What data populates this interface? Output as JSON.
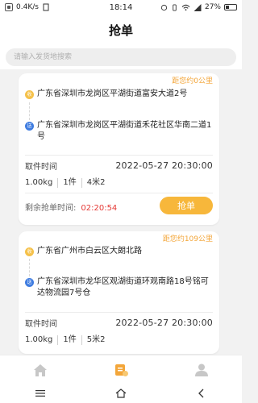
{
  "status_bar": {
    "speed": "0.4K/s",
    "time": "18:14",
    "battery": "27%"
  },
  "header": {
    "title": "抢单"
  },
  "search": {
    "placeholder": "请输入发货地搜索"
  },
  "orders": [
    {
      "distance": "距您约0公里",
      "pickup_badge": "收",
      "pickup_address": "广东省深圳市龙岗区平湖街道富安大道2号",
      "delivery_badge": "送",
      "delivery_address": "广东省深圳市龙岗区平湖街道禾花社区华南二道1号",
      "pickup_time_label": "取件时间",
      "pickup_time": "2022-05-27 20:30:00",
      "weight": "1.00kg",
      "count": "1件",
      "size": "4米2",
      "countdown_label": "剩余抢单时间:",
      "countdown": "02:20:54",
      "grab_label": "抢单"
    },
    {
      "distance": "距您约109公里",
      "pickup_badge": "收",
      "pickup_address": "广东省广州市白云区大朗北路",
      "delivery_badge": "送",
      "delivery_address": "广东省深圳市龙华区观湖街道环观南路18号铭可达物流园7号仓",
      "pickup_time_label": "取件时间",
      "pickup_time": "2022-05-27 20:30:00",
      "weight": "1.00kg",
      "count": "1件",
      "size": "5米2"
    }
  ],
  "tabbar": {
    "items": [
      {
        "icon": "home-icon",
        "active": false
      },
      {
        "icon": "order-grab-icon",
        "active": true
      },
      {
        "icon": "profile-icon",
        "active": false
      }
    ],
    "active_color": "#f3a63a",
    "inactive_color": "#c7c7c7"
  },
  "system_nav": {
    "icons": [
      "menu-icon",
      "home-icon",
      "back-icon"
    ]
  }
}
